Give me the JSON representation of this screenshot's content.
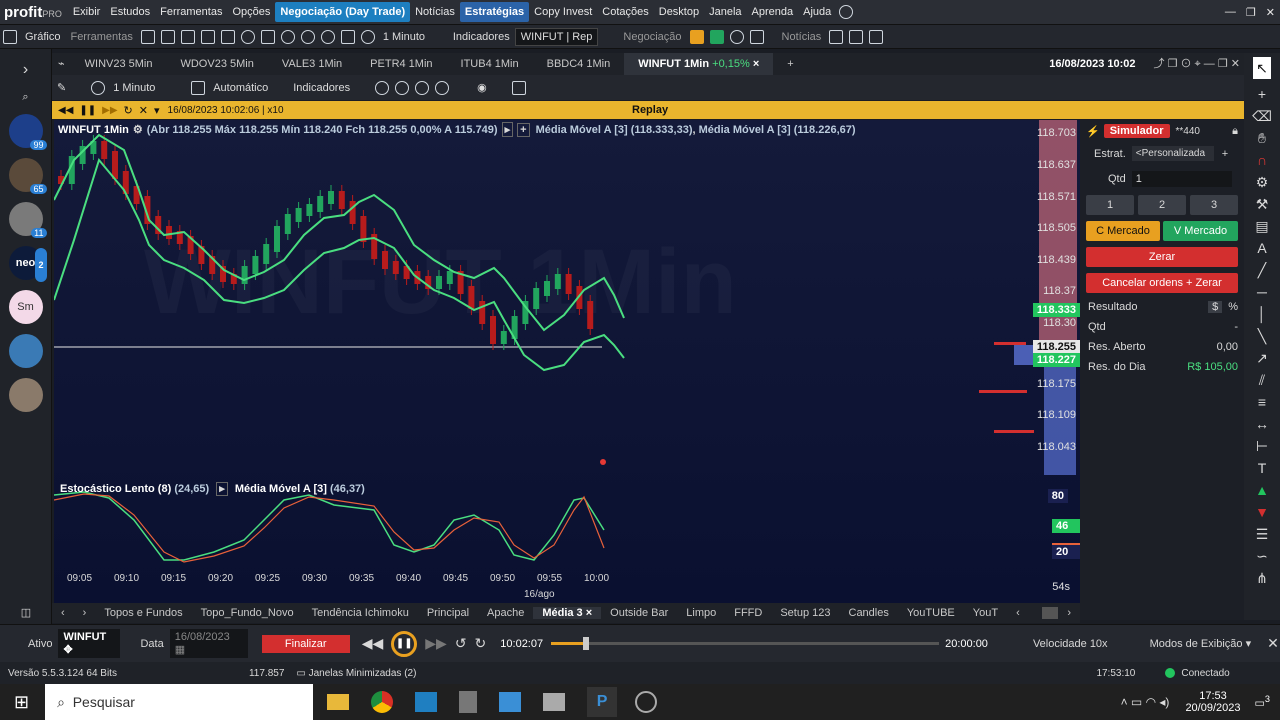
{
  "app": {
    "logo": "profit",
    "logo_suffix": "PRO"
  },
  "menu": [
    "Exibir",
    "Estudos",
    "Ferramentas",
    "Opções",
    "Negociação (Day Trade)",
    "Notícias",
    "Estratégias",
    "Copy Invest",
    "Cotações",
    "Desktop",
    "Janela",
    "Aprenda",
    "Ajuda"
  ],
  "toolbar": {
    "grafico": "Gráfico",
    "ferramentas": "Ferramentas",
    "interval": "1 Minuto",
    "indicadores": "Indicadores",
    "asset": "WINFUT | Rep",
    "negociacao": "Negociação",
    "noticias": "Notícias"
  },
  "tabs": [
    {
      "label": "WINV23 5Min"
    },
    {
      "label": "WDOV23 5Min"
    },
    {
      "label": "VALE3 1Min"
    },
    {
      "label": "PETR4 1Min"
    },
    {
      "label": "ITUB4 1Min"
    },
    {
      "label": "BBDC4 1Min"
    },
    {
      "label": "WINFUT 1Min",
      "change": "+0,15%"
    }
  ],
  "datetime": "16/08/2023 10:02",
  "chart_toolbar": {
    "interval": "1 Minuto",
    "scale": "Automático",
    "indicadores": "Indicadores"
  },
  "replay": {
    "time": "16/08/2023 10:02:06 | x10",
    "title": "Replay"
  },
  "chart": {
    "symbol": "WINFUT 1Min",
    "ohlc": "(Abr 118.255 Máx 118.255 Mín 118.240 Fch 118.255 0,00% A 115.749)",
    "ma1": "Média Móvel A [3] (118.333,33)",
    "ma2": "Média Móvel A [3] (118.226,67)",
    "watermark": "WINFUT 1Min",
    "price_labels": [
      "118.703",
      "118.637",
      "118.571",
      "118.505",
      "118.439",
      "118.37",
      "118.30",
      "118.175",
      "118.109",
      "118.043"
    ],
    "price_tag_green1": "118.333",
    "price_tag_current": "118.255",
    "price_tag_green2": "118.227",
    "stoch_label": "Estocástico Lento (8)",
    "stoch_val": "(24,65)",
    "stoch_ma": "Média Móvel A [3]",
    "stoch_ma_val": "(46,37)",
    "stoch_levels": [
      "80",
      "46",
      "20"
    ],
    "time_labels": [
      "09:05",
      "09:10",
      "09:15",
      "09:20",
      "09:25",
      "09:30",
      "09:35",
      "09:40",
      "09:45",
      "09:50",
      "09:55",
      "10:00"
    ],
    "date_label": "16/ago",
    "period": "54s"
  },
  "panel": {
    "simulador": "Simulador",
    "account": "**440",
    "estrat_label": "Estrat.",
    "estrat_value": "<Personalizada",
    "qtd_label": "Qtd",
    "qtd_value": "1",
    "q1": "1",
    "q2": "2",
    "q3": "3",
    "c_mercado": "C Mercado",
    "v_mercado": "V Mercado",
    "zerar": "Zerar",
    "cancelar": "Cancelar ordens + Zerar",
    "resultado": "Resultado",
    "res_dollar": "$",
    "res_pct": "%",
    "qtd2": "Qtd",
    "qtd2_val": "-",
    "res_aberto": "Res. Aberto",
    "res_aberto_val": "0,00",
    "res_dia": "Res. do Dia",
    "res_dia_val": "R$ 105,00"
  },
  "bottom_tabs": [
    "Topos e Fundos",
    "Topo_Fundo_Novo",
    "Tendência Ichimoku",
    "Principal",
    "Apache",
    "Média 3",
    "Outside Bar",
    "Limpo",
    "FFFD",
    "Setup 123",
    "Candles",
    "YouTUBE",
    "YouT"
  ],
  "playbar": {
    "ativo_label": "Ativo",
    "ativo": "WINFUT",
    "data_label": "Data",
    "data": "16/08/2023",
    "finalizar": "Finalizar",
    "current": "10:02:07",
    "end": "20:00:00",
    "progress": 0.09,
    "velocidade": "Velocidade 10x",
    "modos": "Modos de Exibição"
  },
  "status": {
    "versao": "Versão 5.5.3.124 64 Bits",
    "value": "117.857",
    "janelas": "Janelas Minimizadas (2)",
    "time": "17:53:10",
    "conectado": "Conectado"
  },
  "taskbar": {
    "search": "Pesquisar",
    "time": "17:53",
    "date": "20/09/2023",
    "notif": "3"
  },
  "avatars": [
    {
      "badge": "99"
    },
    {
      "badge": "65"
    },
    {
      "badge": "11"
    },
    {
      "text": "neo",
      "badge": "2"
    },
    {
      "text": "Sm"
    },
    {},
    {}
  ],
  "colors": {
    "green": "#22c55e",
    "red": "#d32f2f",
    "ma_green": "#4ade80",
    "replay_bar": "#e9b52d"
  }
}
